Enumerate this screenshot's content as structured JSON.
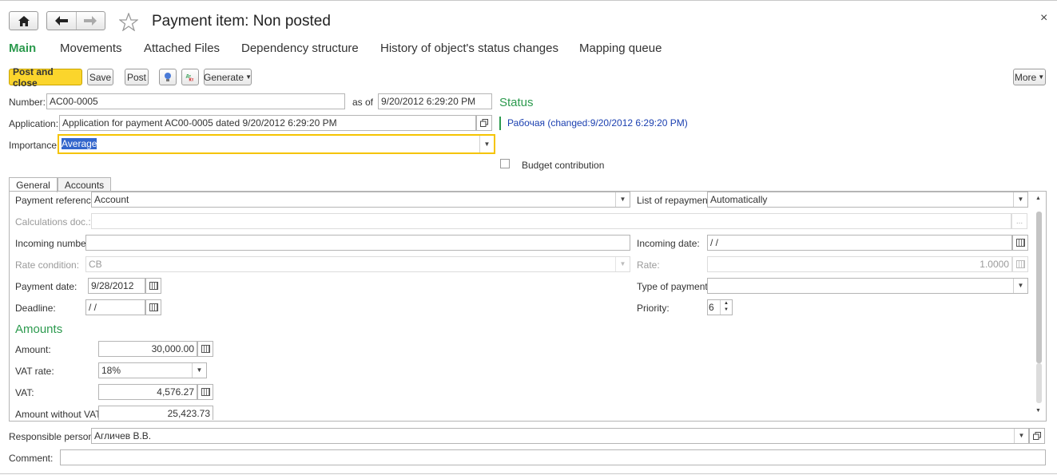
{
  "window": {
    "title": "Payment item: Non posted",
    "close_glyph": "×"
  },
  "nav": {
    "home_icon": "home-icon",
    "back_icon": "back-arrow-icon",
    "forward_icon": "forward-arrow-icon",
    "favorite_icon": "star-icon"
  },
  "tabs": [
    {
      "label": "Main",
      "active": true
    },
    {
      "label": "Movements"
    },
    {
      "label": "Attached Files"
    },
    {
      "label": "Dependency structure"
    },
    {
      "label": "History of object's status changes"
    },
    {
      "label": "Mapping queue"
    }
  ],
  "toolbar": {
    "post_close": "Post and close",
    "save": "Save",
    "post": "Post",
    "generate": "Generate",
    "more": "More"
  },
  "header": {
    "number_label": "Number:",
    "number_value": "AC00-0005",
    "asof_label": "as of",
    "asof_value": "9/20/2012  6:29:20 PM",
    "application_label": "Application:",
    "application_value": "Application for payment AC00-0005 dated 9/20/2012 6:29:20 PM",
    "importance_label": "Importance:",
    "importance_value": "Average",
    "status_heading": "Status",
    "status_value": "Рабочая (changed:9/20/2012 6:29:20 PM)",
    "budget_label": "Budget contribution"
  },
  "panel_tabs": [
    "General",
    "Accounts"
  ],
  "general": {
    "payment_reference_label": "Payment reference:",
    "payment_reference_value": "Account",
    "calc_doc_label": "Calculations doc.:",
    "calc_doc_value": "",
    "incoming_number_label": "Incoming number:",
    "incoming_number_value": "",
    "rate_condition_label": "Rate condition:",
    "rate_condition_value": "CB",
    "payment_date_label": "Payment date:",
    "payment_date_value": "9/28/2012",
    "deadline_label": "Deadline:",
    "deadline_value": " /  /",
    "list_repayment_label": "List of repayment:",
    "list_repayment_value": "Automatically",
    "incoming_date_label": "Incoming date:",
    "incoming_date_value": " /  /",
    "rate_label": "Rate:",
    "rate_value": "1.0000",
    "type_payment_label": "Type of payment:",
    "type_payment_value": "",
    "priority_label": "Priority:",
    "priority_value": "6",
    "calc_doc_btn": "..."
  },
  "amounts": {
    "heading": "Amounts",
    "amount_label": "Amount:",
    "amount_value": "30,000.00",
    "vat_rate_label": "VAT rate:",
    "vat_rate_value": "18%",
    "vat_label": "VAT:",
    "vat_value": "4,576.27",
    "without_vat_label": "Amount without VAT:",
    "without_vat_value": "25,423.73"
  },
  "footer": {
    "responsible_label": "Responsible person:",
    "responsible_value": "Агличев В.В.",
    "comment_label": "Comment:",
    "comment_value": ""
  },
  "colors": {
    "accent_green": "#2c9a4e",
    "primary_yellow": "#fbd52c",
    "status_blue": "#1a3fb0"
  }
}
